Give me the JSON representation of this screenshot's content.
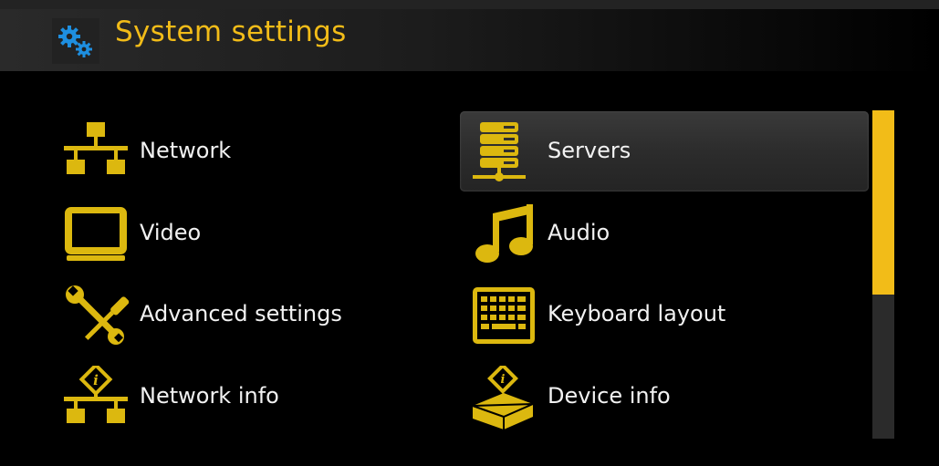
{
  "header": {
    "title": "System settings",
    "icon": "gears-icon"
  },
  "menu": {
    "items": [
      {
        "label": "Network",
        "icon": "network-icon"
      },
      {
        "label": "Servers",
        "icon": "servers-icon",
        "selected": true
      },
      {
        "label": "Video",
        "icon": "video-icon"
      },
      {
        "label": "Audio",
        "icon": "music-note-icon"
      },
      {
        "label": "Advanced settings",
        "icon": "tools-icon"
      },
      {
        "label": "Keyboard layout",
        "icon": "keyboard-icon"
      },
      {
        "label": "Network info",
        "icon": "network-info-icon"
      },
      {
        "label": "Device info",
        "icon": "device-info-icon"
      }
    ]
  },
  "scrollbar": {
    "position_fraction": 0.56
  },
  "colors": {
    "accent": "#f2bc18",
    "background": "#000000",
    "text": "#f2f2f2",
    "header_icon": "#1e8fe0"
  }
}
